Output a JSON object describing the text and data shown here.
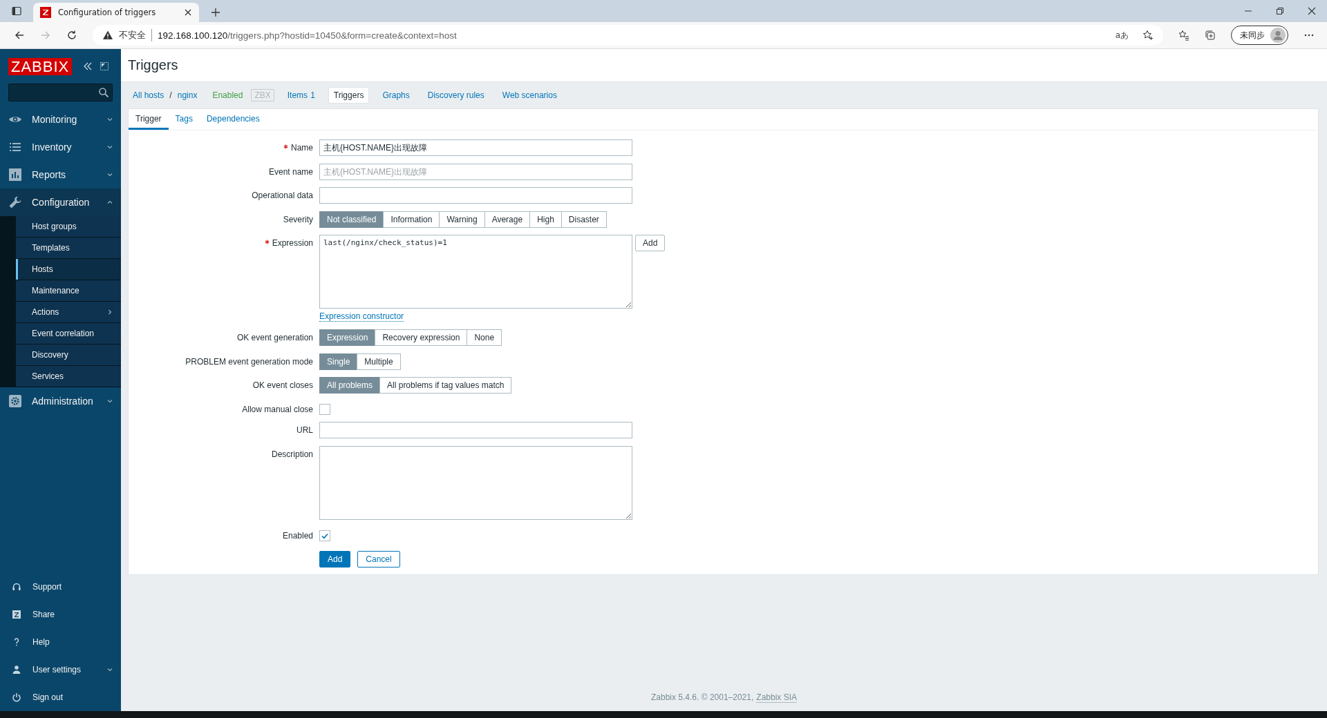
{
  "browser": {
    "tab_title": "Configuration of triggers",
    "security_label": "不安全",
    "url_host": "192.168.100.120",
    "url_path": "/triggers.php?hostid=10450&form=create&context=host",
    "translate_glyph": "aあ",
    "profile_label": "未同步"
  },
  "sidebar": {
    "logo": "ZABBIX",
    "menu": [
      {
        "label": "Monitoring",
        "expanded": false
      },
      {
        "label": "Inventory",
        "expanded": false
      },
      {
        "label": "Reports",
        "expanded": false
      },
      {
        "label": "Configuration",
        "expanded": true,
        "children": [
          {
            "label": "Host groups",
            "selected": false,
            "kind": "link"
          },
          {
            "label": "Templates",
            "selected": false,
            "kind": "link"
          },
          {
            "label": "Hosts",
            "selected": true,
            "kind": "link"
          },
          {
            "label": "Maintenance",
            "selected": false,
            "kind": "link"
          },
          {
            "label": "Actions",
            "selected": false,
            "kind": "submenu"
          },
          {
            "label": "Event correlation",
            "selected": false,
            "kind": "link"
          },
          {
            "label": "Discovery",
            "selected": false,
            "kind": "link"
          },
          {
            "label": "Services",
            "selected": false,
            "kind": "link"
          }
        ]
      },
      {
        "label": "Administration",
        "expanded": false
      }
    ],
    "bottom_menu": [
      {
        "label": "Support",
        "kind": "link"
      },
      {
        "label": "Share",
        "kind": "link"
      },
      {
        "label": "Help",
        "kind": "link"
      },
      {
        "label": "User settings",
        "kind": "menu"
      },
      {
        "label": "Sign out",
        "kind": "link"
      }
    ]
  },
  "page": {
    "title": "Triggers"
  },
  "host_nav": {
    "breadcrumbs": [
      "All hosts",
      "nginx"
    ],
    "breadcrumb_separator": "/",
    "status": "Enabled",
    "availability": {
      "label": "ZBX",
      "active": false
    },
    "tabs": [
      {
        "label": "Items",
        "count": "1",
        "selected": false
      },
      {
        "label": "Triggers",
        "selected": true
      },
      {
        "label": "Graphs",
        "selected": false
      },
      {
        "label": "Discovery rules",
        "selected": false
      },
      {
        "label": "Web scenarios",
        "selected": false
      }
    ]
  },
  "form_tabs": [
    {
      "label": "Trigger",
      "selected": true
    },
    {
      "label": "Tags",
      "selected": false
    },
    {
      "label": "Dependencies",
      "selected": false
    }
  ],
  "fields": [
    {
      "kind": "text",
      "label": "Name",
      "required": true,
      "value": "主机{HOST.NAME}出现故障"
    },
    {
      "kind": "text",
      "label": "Event name",
      "required": false,
      "placeholder": "主机{HOST.NAME}出现故障"
    },
    {
      "kind": "text",
      "label": "Operational data",
      "required": false
    },
    {
      "kind": "segmented",
      "label": "Severity",
      "required": false,
      "options": [
        {
          "label": "Not classified",
          "selected": true
        },
        {
          "label": "Information",
          "selected": false
        },
        {
          "label": "Warning",
          "selected": false
        },
        {
          "label": "Average",
          "selected": false
        },
        {
          "label": "High",
          "selected": false
        },
        {
          "label": "Disaster",
          "selected": false
        }
      ]
    },
    {
      "kind": "expression",
      "label": "Expression",
      "required": true,
      "value": "last(/nginx/check_status)=1",
      "button": "Add",
      "link": "Expression constructor"
    },
    {
      "kind": "segmented",
      "label": "OK event generation",
      "required": false,
      "options": [
        {
          "label": "Expression",
          "selected": true
        },
        {
          "label": "Recovery expression",
          "selected": false
        },
        {
          "label": "None",
          "selected": false
        }
      ]
    },
    {
      "kind": "segmented",
      "label": "PROBLEM event generation mode",
      "required": false,
      "options": [
        {
          "label": "Single",
          "selected": true
        },
        {
          "label": "Multiple",
          "selected": false
        }
      ]
    },
    {
      "kind": "segmented",
      "label": "OK event closes",
      "required": false,
      "options": [
        {
          "label": "All problems",
          "selected": true
        },
        {
          "label": "All problems if tag values match",
          "selected": false
        }
      ]
    },
    {
      "kind": "checkbox",
      "label": "Allow manual close",
      "required": false,
      "checked": false
    },
    {
      "kind": "text",
      "label": "URL",
      "required": false
    },
    {
      "kind": "textarea",
      "label": "Description",
      "required": false
    },
    {
      "kind": "checkbox",
      "label": "Enabled",
      "required": false,
      "checked": true
    }
  ],
  "actions": [
    {
      "label": "Add",
      "kind": "primary"
    },
    {
      "label": "Cancel",
      "kind": "secondary"
    }
  ],
  "footer": {
    "text": "Zabbix 5.4.6. © 2001–2021,",
    "link": "Zabbix SIA"
  }
}
